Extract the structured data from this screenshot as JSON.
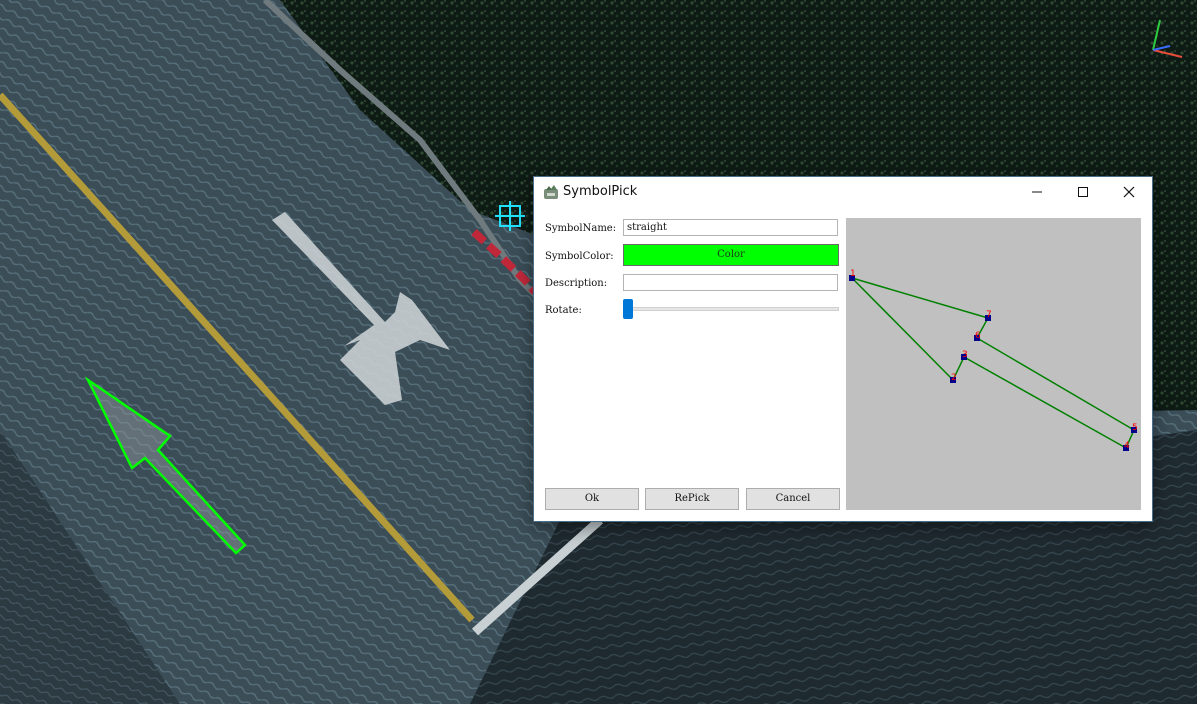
{
  "window": {
    "title": "SymbolPick"
  },
  "form": {
    "symbol_name_label": "SymbolName:",
    "symbol_name_value": "straight",
    "symbol_color_label": "SymbolColor:",
    "color_button_label": "Color",
    "color_value": "#00ff00",
    "description_label": "Description:",
    "description_value": "",
    "rotate_label": "Rotate:",
    "rotate_value": 0
  },
  "buttons": {
    "ok": "Ok",
    "repick": "RePick",
    "cancel": "Cancel"
  },
  "preview": {
    "point_labels": [
      "1",
      "2",
      "3",
      "4",
      "5",
      "6",
      "7"
    ],
    "line_color": "#008000",
    "point_color": "#00008b",
    "label_color": "#ff0000"
  },
  "scene": {
    "symbol_outline_color": "#00ff00"
  }
}
